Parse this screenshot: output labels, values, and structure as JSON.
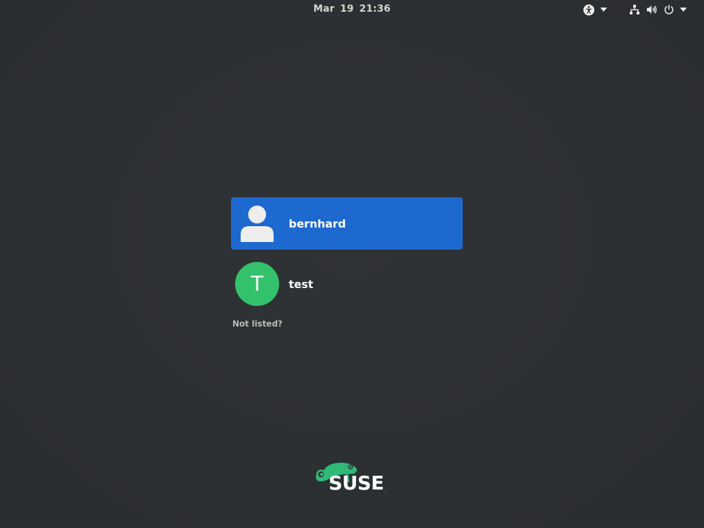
{
  "topbar": {
    "date": "Mar 19",
    "time": "21:36",
    "icons": [
      "accessibility-icon",
      "network-wired-icon",
      "volume-icon",
      "power-icon"
    ]
  },
  "users": [
    {
      "name": "bernhard",
      "avatar": "generic-person-icon",
      "selected": true
    },
    {
      "name": "test",
      "avatar_letter": "T",
      "avatar_color": "#33c26b",
      "selected": false
    }
  ],
  "not_listed_label": "Not listed?",
  "logo": {
    "text": "SUSE",
    "registered": "."
  },
  "colors": {
    "background": "#2d3033",
    "selection": "#1e69d0",
    "logo_green": "#30ba78"
  }
}
